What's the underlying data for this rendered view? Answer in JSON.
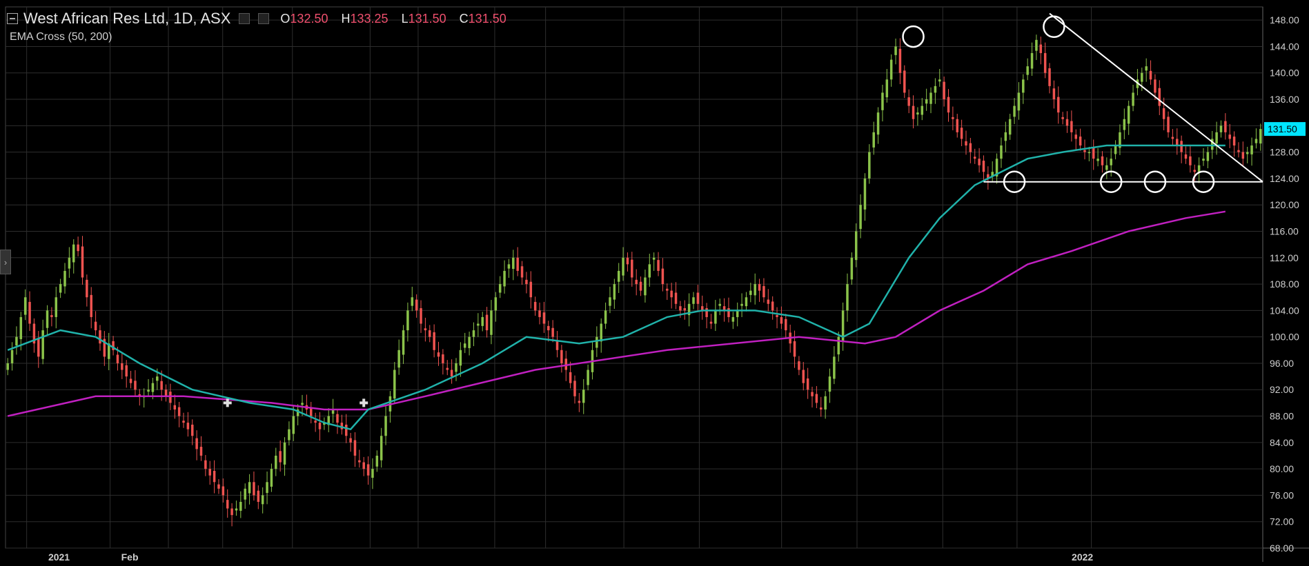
{
  "header": {
    "symbol_title": "West African Res Ltd, 1D, ASX",
    "open_key": "O",
    "open_value": "132.50",
    "high_key": "H",
    "high_value": "133.25",
    "low_key": "L",
    "low_value": "131.50",
    "close_key": "C",
    "close_value": "131.50"
  },
  "indicator": {
    "label": "EMA Cross (50, 200)"
  },
  "colors": {
    "up": "#8bc34a",
    "down": "#ef5350",
    "ema50": "#20b2aa",
    "ema200": "#c020c0",
    "grid": "#2e2e2e",
    "price_label_bg": "#00e5ff"
  },
  "chart_data": {
    "type": "candlestick",
    "ylim": [
      68,
      150
    ],
    "y_ticks": [
      "148.00",
      "144.00",
      "140.00",
      "136.00",
      "132.00",
      "128.00",
      "124.00",
      "120.00",
      "116.00",
      "112.00",
      "108.00",
      "104.00",
      "100.00",
      "96.00",
      "92.00",
      "88.00",
      "84.00",
      "80.00",
      "76.00",
      "72.00",
      "68.00"
    ],
    "x_tick_labels": [
      "2021",
      "Feb",
      "2022"
    ],
    "last_price_label": "131.50",
    "closes": [
      96,
      98,
      100,
      103,
      106,
      102,
      99,
      97,
      101,
      104,
      103,
      106,
      108,
      110,
      112,
      114,
      113,
      109,
      106,
      103,
      101,
      99,
      97,
      99,
      98,
      96,
      95,
      94,
      93,
      92,
      91,
      91,
      92,
      93,
      94,
      92,
      91,
      90,
      89,
      88,
      87,
      86,
      85,
      83,
      82,
      80,
      79,
      78,
      77,
      76,
      74,
      73,
      74,
      75,
      77,
      78,
      76,
      75,
      76,
      78,
      80,
      82,
      81,
      84,
      86,
      88,
      89,
      90,
      89,
      88,
      87,
      86,
      87,
      88,
      89,
      87,
      86,
      85,
      84,
      82,
      81,
      80,
      79,
      80,
      82,
      85,
      88,
      91,
      95,
      98,
      101,
      104,
      106,
      104,
      102,
      101,
      100,
      98,
      97,
      96,
      95,
      94,
      96,
      98,
      99,
      100,
      101,
      102,
      103,
      101,
      104,
      106,
      108,
      110,
      111,
      112,
      110,
      109,
      108,
      106,
      104,
      103,
      102,
      101,
      100,
      98,
      96,
      95,
      93,
      91,
      90,
      92,
      95,
      98,
      100,
      102,
      104,
      106,
      108,
      110,
      112,
      111,
      109,
      108,
      107,
      109,
      111,
      112,
      110,
      108,
      107,
      106,
      105,
      104,
      104,
      105,
      106,
      105,
      104,
      103,
      102,
      104,
      105,
      104,
      103,
      103,
      104,
      105,
      106,
      107,
      108,
      107,
      106,
      105,
      104,
      103,
      102,
      101,
      99,
      97,
      95,
      93,
      92,
      91,
      90,
      89,
      91,
      94,
      97,
      100,
      104,
      108,
      112,
      116,
      120,
      124,
      128,
      131,
      134,
      137,
      139,
      142,
      144,
      140,
      137,
      135,
      133,
      134,
      135,
      136,
      137,
      138,
      139,
      136,
      134,
      133,
      131,
      130,
      129,
      128,
      127,
      126,
      125,
      124,
      125,
      127,
      129,
      131,
      133,
      135,
      137,
      139,
      141,
      143,
      145,
      143,
      140,
      138,
      136,
      134,
      133,
      132,
      131,
      130,
      129,
      128,
      128,
      127,
      127,
      126,
      126,
      127,
      129,
      131,
      133,
      135,
      137,
      139,
      140,
      141,
      139,
      137,
      135,
      133,
      131,
      130,
      129,
      128,
      127,
      126,
      125,
      126,
      127,
      128,
      130,
      131,
      132,
      131,
      130,
      129,
      128,
      127,
      128,
      129,
      130,
      131.5
    ],
    "ema50_points": [
      [
        0,
        98
      ],
      [
        4,
        99
      ],
      [
        12,
        101
      ],
      [
        20,
        100
      ],
      [
        30,
        96
      ],
      [
        42,
        92
      ],
      [
        55,
        90
      ],
      [
        65,
        89
      ],
      [
        72,
        87
      ],
      [
        78,
        86
      ],
      [
        82,
        89
      ],
      [
        95,
        92
      ],
      [
        108,
        96
      ],
      [
        118,
        100
      ],
      [
        130,
        99
      ],
      [
        140,
        100
      ],
      [
        150,
        103
      ],
      [
        158,
        104
      ],
      [
        170,
        104
      ],
      [
        180,
        103
      ],
      [
        190,
        100
      ],
      [
        196,
        102
      ],
      [
        205,
        112
      ],
      [
        212,
        118
      ],
      [
        220,
        123
      ],
      [
        232,
        127
      ],
      [
        240,
        128
      ],
      [
        250,
        129
      ],
      [
        260,
        129
      ],
      [
        270,
        129
      ],
      [
        277,
        129
      ]
    ],
    "ema200_points": [
      [
        0,
        88
      ],
      [
        20,
        91
      ],
      [
        40,
        91
      ],
      [
        60,
        90
      ],
      [
        72,
        89
      ],
      [
        82,
        89
      ],
      [
        95,
        91
      ],
      [
        120,
        95
      ],
      [
        150,
        98
      ],
      [
        180,
        100
      ],
      [
        195,
        99
      ],
      [
        202,
        100
      ],
      [
        212,
        104
      ],
      [
        222,
        107
      ],
      [
        232,
        111
      ],
      [
        242,
        113
      ],
      [
        255,
        116
      ],
      [
        268,
        118
      ],
      [
        277,
        119
      ]
    ],
    "crosses": [
      [
        50,
        90
      ],
      [
        81,
        90
      ]
    ],
    "support_line": [
      [
        222,
        123.5
      ],
      [
        300,
        123.5
      ]
    ],
    "resistance_line": [
      [
        237,
        149
      ],
      [
        300,
        123.5
      ]
    ],
    "circles": [
      [
        206,
        145.5
      ],
      [
        238,
        147
      ],
      [
        229,
        123.5
      ],
      [
        251,
        123.5
      ],
      [
        261,
        123.5
      ],
      [
        272,
        123.5
      ]
    ]
  }
}
